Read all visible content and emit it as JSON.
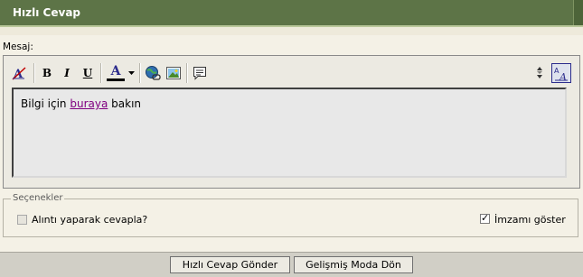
{
  "header": {
    "title": "Hızlı Cevap"
  },
  "editor": {
    "label": "Mesaj:",
    "content": {
      "before": "Bilgi için ",
      "link": "buraya",
      "after": " bakın"
    },
    "toolbar": {
      "buttons": [
        {
          "name": "remove-format-icon"
        },
        {
          "name": "bold-button",
          "glyph": "B"
        },
        {
          "name": "italic-button",
          "glyph": "I"
        },
        {
          "name": "underline-button",
          "glyph": "U"
        },
        {
          "name": "font-color-icon",
          "glyph": "A",
          "color": "#000000"
        },
        {
          "name": "insert-link-icon"
        },
        {
          "name": "insert-image-icon"
        },
        {
          "name": "quote-icon"
        }
      ],
      "mode_toggle_glyph": "A"
    }
  },
  "options": {
    "legend": "Seçenekler",
    "quote_reply": {
      "label": "Alıntı yaparak cevapla?",
      "checked": false,
      "disabled": true
    },
    "show_signature": {
      "label": "İmzamı göster",
      "checked": true
    }
  },
  "buttons": {
    "submit": "Hızlı Cevap Gönder",
    "advanced": "Gelişmiş Moda Dön"
  },
  "colors": {
    "header_bg": "#5d7447",
    "page_bg": "#f4f1e6",
    "link": "#800080"
  }
}
